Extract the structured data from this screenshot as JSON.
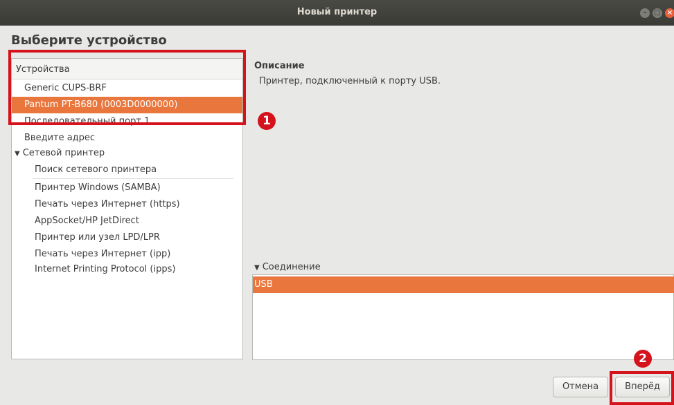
{
  "window": {
    "title": "Новый принтер"
  },
  "heading": "Выберите устройство",
  "devices": {
    "header": "Устройства",
    "items": [
      {
        "label": "Generic CUPS-BRF",
        "selected": false
      },
      {
        "label": "Pantum PT-B680 (0003D0000000)",
        "selected": true
      },
      {
        "label": "Последовательный порт 1",
        "selected": false
      },
      {
        "label": "Введите адрес",
        "selected": false
      }
    ],
    "network_group": {
      "label": "Сетевой принтер",
      "expanded": true,
      "items": [
        "Поиск сетевого принтера",
        "Принтер Windows (SAMBA)",
        "Печать через Интернет (https)",
        "AppSocket/HP JetDirect",
        "Принтер или узел LPD/LPR",
        "Печать через Интернет (ipp)",
        "Internet Printing Protocol (ipps)"
      ]
    }
  },
  "description": {
    "label": "Описание",
    "text": "Принтер, подключенный к порту USB."
  },
  "connection": {
    "label": "Соединение",
    "items": [
      {
        "label": "USB",
        "selected": true
      }
    ]
  },
  "buttons": {
    "cancel": "Отмена",
    "forward": "Вперёд"
  },
  "annotations": {
    "step1": "1",
    "step2": "2"
  },
  "colors": {
    "selection": "#e9773d",
    "highlight": "#d4131d",
    "titlebar": "#3e3e3a"
  },
  "icons": {
    "expand": "triangle-down-icon",
    "window_close": "close-icon",
    "window_minimize": "minimize-icon",
    "window_maximize": "maximize-icon"
  }
}
